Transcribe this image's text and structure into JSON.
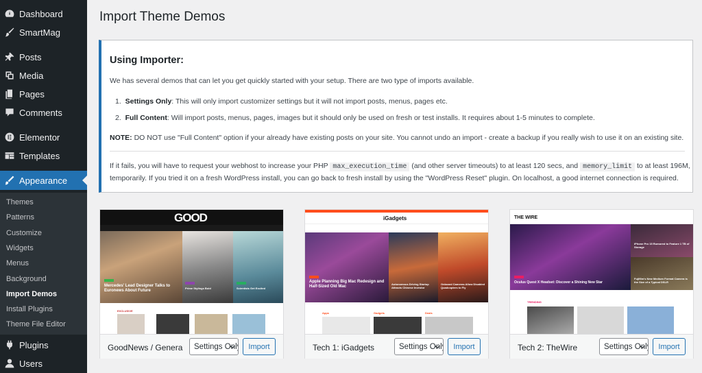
{
  "sidebar": {
    "items": [
      {
        "label": "Dashboard",
        "icon": "dashboard-icon"
      },
      {
        "label": "SmartMag",
        "icon": "brush-icon"
      },
      {
        "label": "Posts",
        "icon": "pin-icon"
      },
      {
        "label": "Media",
        "icon": "media-icon"
      },
      {
        "label": "Pages",
        "icon": "pages-icon"
      },
      {
        "label": "Comments",
        "icon": "comments-icon"
      },
      {
        "label": "Elementor",
        "icon": "elementor-icon"
      },
      {
        "label": "Templates",
        "icon": "templates-icon"
      },
      {
        "label": "Appearance",
        "icon": "appearance-icon"
      },
      {
        "label": "Plugins",
        "icon": "plugins-icon"
      },
      {
        "label": "Users",
        "icon": "users-icon"
      }
    ],
    "submenu": [
      "Themes",
      "Patterns",
      "Customize",
      "Widgets",
      "Menus",
      "Background",
      "Import Demos",
      "Install Plugins",
      "Theme File Editor"
    ]
  },
  "page": {
    "title": "Import Theme Demos"
  },
  "info": {
    "heading": "Using Importer:",
    "intro": "We has several demos that can let you get quickly started with your setup. There are two type of imports available.",
    "li1_num": "1.",
    "li1_bold": "Settings Only",
    "li1_text": ": This will only import customizer settings but it will not import posts, menus, pages etc.",
    "li2_num": "2.",
    "li2_bold": "Full Content",
    "li2_text": ": Will import posts, menus, pages, images but it should only be used on fresh or test installs. It requires about 1-5 minutes to complete.",
    "note_bold": "NOTE:",
    "note_text": " DO NOT use \"Full Content\" option if your already have existing posts on your site. You cannot undo an import - create a backup if you really wish to use it on an existing site.",
    "fail_a": "If it fails, you will have to request your webhost to increase your PHP",
    "fail_code1": "max_execution_time",
    "fail_b": "(and other server timeouts) to at least 120 secs, and",
    "fail_code2": "memory_limit",
    "fail_c": "to at least 196M,",
    "fail_line2": "temporarily. If you tried it on a fresh WordPress install, you can go back to fresh install by using the \"WordPress Reset\" plugin. On localhost, a good internet connection is required."
  },
  "demos": [
    {
      "name": "GoodNews / General",
      "select": "Settings Only",
      "import_label": "Import",
      "logo": "GOOD",
      "hero_caption_1": "Mercedes' Lead Designer Talks to Euronews About Future",
      "hero_caption_2": "Prime Stylings Bold",
      "hero_caption_3": "Scientists Get Excited",
      "section": "EXCLUSIVE"
    },
    {
      "name": "Tech 1: iGadgets",
      "select": "Settings Only",
      "import_label": "Import",
      "logo": "iGadgets",
      "hero_caption_1": "Apple Planning Big Mac Redesign and Half-Sized Old Mac",
      "hero_caption_2": "Autonomous Driving Startup Attracts Chinese Investor",
      "hero_caption_3": "Onboard Cameras Allow Disabled Quadcopters to Fly",
      "section_1": "Apps",
      "section_2": "Gadgets",
      "section_3": "Deals"
    },
    {
      "name": "Tech 2: TheWire",
      "select": "Settings Only",
      "import_label": "Import",
      "logo": "THE WIRE",
      "hero_caption_1": "Oculus Quest X Headset: Discover a Shining New Star",
      "hero_caption_2": "iPhone Pro 15 Rumored to Feature 1 TB of Storage",
      "hero_caption_3": "Fujifilm's New Medium Format Camera is the Size of a Typical DSLR",
      "section": "TRENDING"
    }
  ],
  "colors": {
    "sidebar_bg": "#1d2327",
    "accent": "#2271b1",
    "igadgets_orange": "#ff4d1c",
    "wire_pink": "#e91e63"
  }
}
